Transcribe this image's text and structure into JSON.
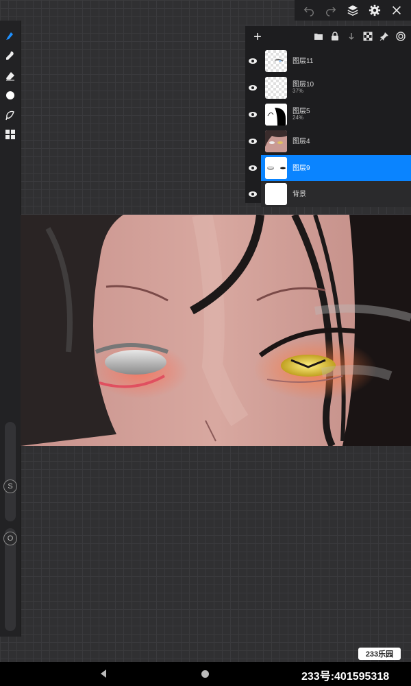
{
  "canvas": {
    "background_color": "#303032",
    "grid_color": "#3a3a3d"
  },
  "topbar": {
    "icons": [
      "undo-icon",
      "redo-icon",
      "layers-icon",
      "gear-icon",
      "close-icon"
    ]
  },
  "left_toolbar": {
    "tools": [
      "brush-icon",
      "smudge-icon",
      "eraser-icon",
      "color-icon",
      "lasso-icon",
      "gallery-icon"
    ],
    "size_slider_label": "S",
    "opacity_slider_label": "O"
  },
  "layers_panel": {
    "add_label": "+",
    "toolbar_icons": [
      "folder-icon",
      "lock-icon",
      "merge-down-icon",
      "checker-icon",
      "pin-icon",
      "target-icon"
    ],
    "layers": [
      {
        "name": "图层11",
        "opacity": "",
        "selected": false
      },
      {
        "name": "图层10",
        "opacity": "37%",
        "selected": false
      },
      {
        "name": "图层5",
        "opacity": "24%",
        "selected": false
      },
      {
        "name": "图层4",
        "opacity": "",
        "selected": false
      },
      {
        "name": "图层9",
        "opacity": "",
        "selected": true
      },
      {
        "name": "背景",
        "opacity": "",
        "selected": false
      }
    ],
    "accent_color": "#0a84ff"
  },
  "watermark": {
    "logo_text": "233乐园",
    "id_text": "233号:401595318"
  }
}
